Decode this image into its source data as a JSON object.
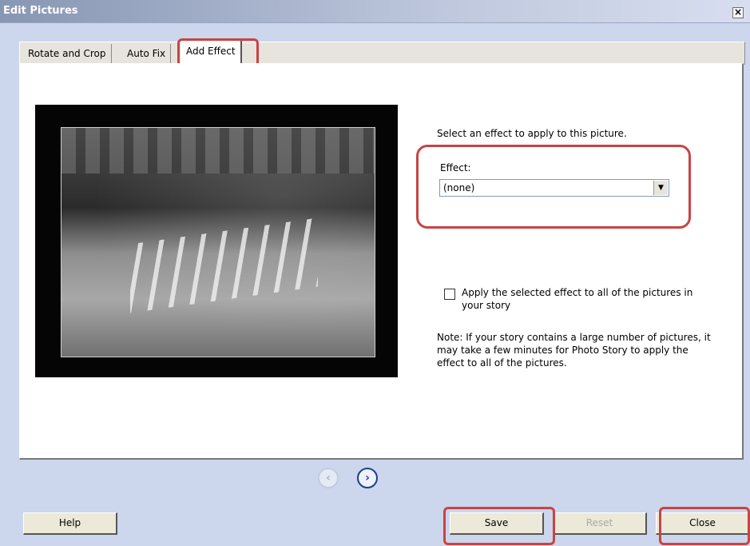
{
  "window": {
    "title": "Edit Pictures",
    "close_glyph": "×"
  },
  "tabs": [
    {
      "label": "Rotate and Crop",
      "active": false
    },
    {
      "label": "Auto Fix",
      "active": false
    },
    {
      "label": "Add Effect",
      "active": true
    }
  ],
  "effect_panel": {
    "instruction": "Select an effect to apply to this picture.",
    "effect_label": "Effect:",
    "effect_value": "(none)",
    "apply_all_label": "Apply the selected effect to all of the pictures in your story",
    "apply_all_checked": false,
    "note": "Note: If your story contains a large number of pictures, it may take a few minutes for Photo Story to apply the effect to all of the pictures."
  },
  "navigation": {
    "prev_glyph": "‹",
    "next_glyph": "›",
    "prev_enabled": false,
    "next_enabled": true
  },
  "buttons": {
    "help": "Help",
    "save": "Save",
    "reset": "Reset",
    "close": "Close"
  },
  "highlight_color": "#c84444"
}
